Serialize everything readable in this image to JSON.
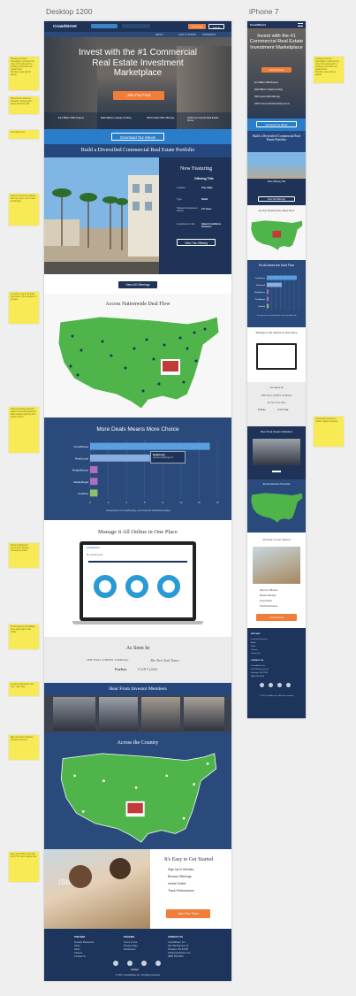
{
  "board": {
    "desktop_label": "Desktop 1200",
    "phone_label": "iPhone 7"
  },
  "notes": [
    "Strategy overview - homepage to enhance the value of investing with a leading commercial real estate brand.\nPriorities: clear path to signup",
    "Show brand. Add trust indicators. Strong call to action above the fold.",
    "Secondary CTA",
    "Feature current live offering with key terms. Link to view all offerings.",
    "Interactive map of all deals nationwide. Click markers to preview.",
    "Chart comparing deal flow against competing platforms. Data updated quarterly from public sources.",
    "Product dashboard screenshot. Manage investments online.",
    "Press logos build credibility. Keep grayscale to stay subtle.",
    "Investor testimonials with short video clips.",
    "Map of investor locations across the country.",
    "Easy onboarding steps with final CTA. Link to signup flow.",
    "Testimonial carousel on mobile. Swipe to browse."
  ],
  "nav": {
    "logo": "CrowdStreet",
    "links": [
      "ABOUT",
      "HOW IT WORKS",
      "OFFERINGS"
    ],
    "signup": "Join Free",
    "login": "Log In"
  },
  "hero": {
    "title": "Invest with the #1 Commercial Real Estate Investment Marketplace",
    "cta": "Join For Free",
    "stats": [
      "$1.4 Billion CRE Projects",
      "$420 Million in Equity Funding",
      "350 Funded CRE Offerings",
      "100% Commercial Real Estate Focus"
    ]
  },
  "download": {
    "label": "Download Our eBook"
  },
  "portfolio": {
    "title": "Build a Diversified Commercial Real Estate Portfolio",
    "now_featuring": "Now Featuring",
    "offering_title": "Offering Title",
    "rows": [
      {
        "k": "Location",
        "v": "City, State"
      },
      {
        "k": "Type",
        "v": "Retail"
      },
      {
        "k": "Targeted Investment Period",
        "v": "3-5 Years"
      },
      {
        "k": "Investment on the",
        "v": "Select Conditions Investors"
      }
    ],
    "view_offering": "View This Offering",
    "view_all": "View All Offerings"
  },
  "deal_map": {
    "title": "Access Nationwide Deal Flow"
  },
  "deals": {
    "title": "More Deals Means More Choice",
    "tooltip": "RealCrowd",
    "tooltip_sub": "Current Offerings: 9",
    "footnote": "*Assessment of crowdfunding, can't read the withdrawal ending"
  },
  "chart_data": {
    "type": "bar",
    "orientation": "horizontal",
    "categories": [
      "CrowdStreet",
      "RealCrowd",
      "RealtyShares",
      "RealtyMogul",
      "Fundrise"
    ],
    "values": [
      32,
      16,
      2,
      2,
      2
    ],
    "xlim": [
      0,
      34
    ],
    "xticks": [
      "0",
      "2",
      "4",
      "6",
      "8",
      "10",
      "12",
      "14"
    ],
    "colors": [
      "#5aa0e0",
      "#8aaee0",
      "#b46cc0",
      "#b46cc0",
      "#8fc06a"
    ]
  },
  "manage": {
    "title": "Manage it All Online in One Place",
    "app": "crowdstreet",
    "app_sub": "My Investments"
  },
  "press": {
    "title": "As Seen In",
    "logos": [
      "THE WALL STREET JOURNAL",
      "The New York Times",
      "Forbes",
      "FORTUNE"
    ]
  },
  "members": {
    "title": "Hear From Investor Members"
  },
  "across": {
    "title": "Across the Country"
  },
  "started": {
    "title": "It's Easy to Get Started",
    "steps": [
      "Sign Up in Minutes",
      "Browse Offerings",
      "Invest Online",
      "Track Performance"
    ],
    "cta": "Join For Free",
    "watermark": "iStock"
  },
  "footer": {
    "cols": [
      {
        "h": "SITE MAP",
        "items": [
          "Investor Resources",
          "About",
          "News",
          "Careers",
          "Contact Us"
        ]
      },
      {
        "h": "POLICIES",
        "items": [
          "Terms of Use",
          "Privacy Policy",
          "Disclosures"
        ]
      },
      {
        "h": "CONTACT US",
        "items": [
          "CrowdStreet, Inc.",
          "621 SW Morrison St.",
          "Portland, OR 97205",
          "info@crowdstreet.com",
          "(888) 556-3815"
        ]
      }
    ],
    "badge": "Verified",
    "copy": "© 2017 CrowdStreet Inc. All rights reserved."
  },
  "mobile": {
    "logo": "CrowdStreet",
    "hero_title": "Invest with the #1 Commercial Real Estate Investment Marketplace",
    "cta": "Join For Free",
    "stats": [
      "$1.4 Billion CRE Projects",
      "$420 Million in Equity Funding",
      "350 Funded CRE Offerings",
      "100% Commercial Real Estate Focus"
    ],
    "download": "Download Our eBook",
    "portfolio": "Build a Diversified Commercial Real Estate Portfolio",
    "now_featuring": "Now Offering Title",
    "view_all": "View All Offerings",
    "map_title": "Access Nationwide Deal Flow",
    "chart_title": "It's All About the Deal Flow",
    "chart_note": "*assessment of crowdfunding sites based on public data",
    "manage": "Manage it All Online in One Place",
    "press": "As Seen In",
    "press_logos": [
      "THE WALL STREET JOURNAL",
      "The New York Times",
      "Forbes",
      "FORTUNE"
    ],
    "members": "Hear From Investor Members",
    "favorites": "Recent Investor Favorites",
    "started": "It's Easy to Get Started",
    "steps": [
      "Sign Up in Minutes",
      "Browse Offerings",
      "Invest Online",
      "Track Performance"
    ],
    "join": "Join For Free",
    "footer_head": "SITE MAP",
    "footer_items": [
      "Investor Resources",
      "About",
      "News",
      "Careers",
      "Contact Us"
    ],
    "contact_head": "CONTACT US",
    "contact_items": [
      "CrowdStreet, Inc.",
      "621 SW Morrison St.",
      "Portland, OR 97205",
      "(888) 556-3815"
    ],
    "copy": "© 2017 CrowdStreet Inc. All rights reserved."
  }
}
